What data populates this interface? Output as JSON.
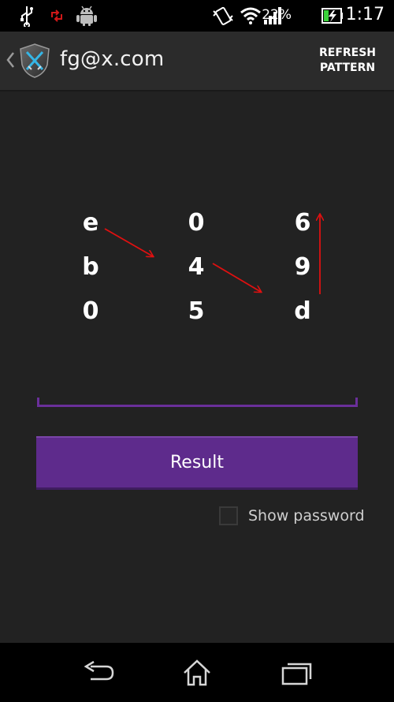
{
  "status_bar": {
    "battery_percent": "22%",
    "time": "1:17",
    "icons": [
      "usb-icon",
      "sync-icon",
      "android-icon",
      "vibrate-icon",
      "wifi-icon",
      "signal-icon",
      "battery-icon"
    ]
  },
  "action_bar": {
    "title": "fg@x.com",
    "refresh_line1": "REFRESH",
    "refresh_line2": "PATTERN"
  },
  "pattern": {
    "rows": [
      [
        "e",
        "0",
        "6"
      ],
      [
        "b",
        "4",
        "9"
      ],
      [
        "0",
        "5",
        "d"
      ]
    ],
    "arrow_color": "#e01010"
  },
  "input": {
    "value": "",
    "placeholder": ""
  },
  "result_button": {
    "label": "Result"
  },
  "show_password": {
    "label": "Show password",
    "checked": false
  },
  "colors": {
    "accent": "#5e2b8c",
    "background": "#222222"
  },
  "nav_bar": {
    "buttons": [
      "back-icon",
      "home-icon",
      "recent-apps-icon"
    ]
  }
}
